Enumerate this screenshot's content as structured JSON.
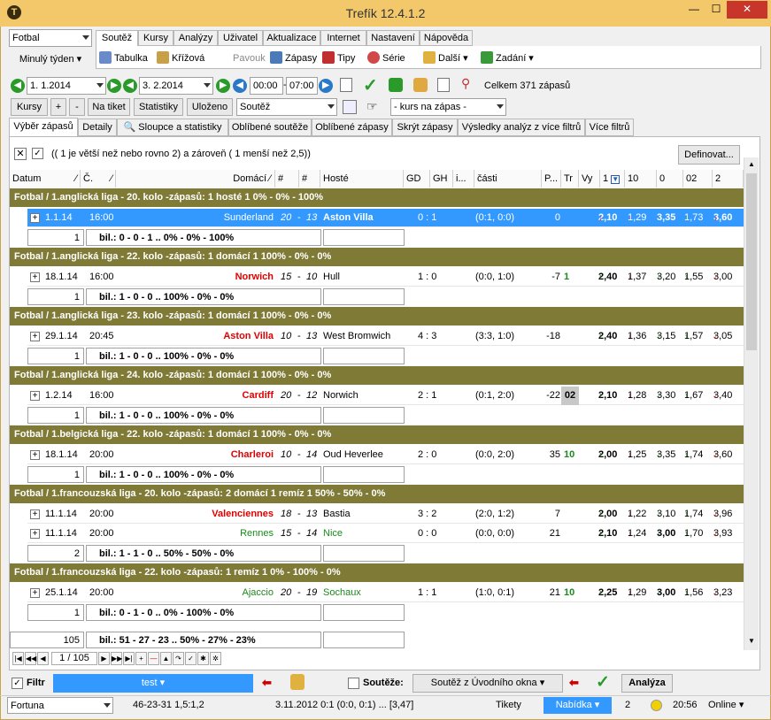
{
  "app": {
    "title": "Trefík 12.4.1.2",
    "min": "—",
    "max": "☐",
    "close": "✕",
    "icon": "T"
  },
  "left": {
    "sport": "Fotbal",
    "period": "Minulý týden"
  },
  "menu": [
    "Soutěž",
    "Kursy",
    "Analýzy",
    "Uživatel",
    "Aktualizace",
    "Internet",
    "Nastavení",
    "Nápověda"
  ],
  "tools": [
    "Tabulka",
    "Křížová",
    "Pavouk",
    "Zápasy",
    "Tipy",
    "Série",
    "Další",
    "Zadání"
  ],
  "dates": {
    "from": "1.  1.2014",
    "to": "3.  2.2014",
    "time_from": "00:00",
    "time_to": "07:00",
    "total": "Celkem 371 zápasů"
  },
  "row3": {
    "kursy": "Kursy",
    "plus": "+",
    "minus": "-",
    "na_tiket": "Na tiket",
    "statistiky": "Statistiky",
    "ulozeno": "Uloženo",
    "soutez": "Soutěž",
    "kurs": "- kurs na zápas -"
  },
  "tabs": [
    "Výběr zápasů",
    "Detaily",
    "Sloupce a statistiky",
    "Oblíbené soutěže",
    "Oblíbené zápasy",
    "Skrýt zápasy",
    "Výsledky analýz z více filtrů",
    "Více filtrů"
  ],
  "filter_text": "(( 1 je větší než nebo rovno 2) a zároveň ( 1 menší než 2,5))",
  "define_btn": "Definovat...",
  "cols": [
    "Datum",
    "Č.",
    "Domácí",
    "#",
    "#",
    "Hosté",
    "GD",
    "GH",
    "i...",
    "části",
    "P...",
    "Tr",
    "Vy",
    "1",
    "10",
    "0",
    "02",
    "2"
  ],
  "groups": [
    {
      "title": "Fotbal / 1.anglická liga - 20. kolo -zápasů: 1   hosté 1     0% - 0% - 100%",
      "rows": [
        {
          "d": "1.1.14",
          "t": "16:00",
          "h": "Sunderland",
          "hc": "n",
          "s1": "20",
          "s2": "13",
          "a": "Aston Villa",
          "ac": "b",
          "sc": "0 : 1",
          "p": "(0:1, 0:0)",
          "pn": "0",
          "tr": "",
          "o1": "2,10",
          "o2": "1,29",
          "o3": "3,35",
          "o4": "1,73",
          "o5": "3,60",
          "sel": true
        }
      ],
      "sum": {
        "n": "1",
        "txt": "bil.: 0 - 0 - 1 .. 0% - 0% - 100%"
      }
    },
    {
      "title": "Fotbal / 1.anglická liga - 22. kolo -zápasů: 1  domácí 1          100% - 0% - 0%",
      "rows": [
        {
          "d": "18.1.14",
          "t": "16:00",
          "h": "Norwich",
          "hc": "r",
          "s1": "15",
          "s2": "10",
          "a": "Hull",
          "ac": "",
          "sc": "1 : 0",
          "p": "(0:0, 1:0)",
          "pn": "-7",
          "tr": "1",
          "o1": "2,40",
          "o2": "1,37",
          "o3": "3,20",
          "o4": "1,55",
          "o5": "3,00"
        }
      ],
      "sum": {
        "n": "1",
        "txt": "bil.: 1 - 0 - 0 .. 100% - 0% - 0%"
      }
    },
    {
      "title": "Fotbal / 1.anglická liga - 23. kolo -zápasů: 1  domácí 1          100% - 0% - 0%",
      "rows": [
        {
          "d": "29.1.14",
          "t": "20:45",
          "h": "Aston Villa",
          "hc": "r",
          "s1": "10",
          "s2": "13",
          "a": "West Bromwich",
          "ac": "",
          "sc": "4 : 3",
          "p": "(3:3, 1:0)",
          "pn": "-18",
          "tr": "",
          "o1": "2,40",
          "o2": "1,36",
          "o3": "3,15",
          "o4": "1,57",
          "o5": "3,05"
        }
      ],
      "sum": {
        "n": "1",
        "txt": "bil.: 1 - 0 - 0 .. 100% - 0% - 0%"
      }
    },
    {
      "title": "Fotbal / 1.anglická liga - 24. kolo -zápasů: 1  domácí 1          100% - 0% - 0%",
      "rows": [
        {
          "d": "1.2.14",
          "t": "16:00",
          "h": "Cardiff",
          "hc": "r",
          "s1": "20",
          "s2": "12",
          "a": "Norwich",
          "ac": "",
          "sc": "2 : 1",
          "p": "(0:1, 2:0)",
          "pn": "-22",
          "tr": "02",
          "o1": "2,10",
          "o2": "1,28",
          "o3": "3,30",
          "o4": "1,67",
          "o5": "3,40"
        }
      ],
      "sum": {
        "n": "1",
        "txt": "bil.: 1 - 0 - 0 .. 100% - 0% - 0%"
      }
    },
    {
      "title": "Fotbal / 1.belgická liga - 22. kolo -zápasů: 1  domácí 1          100% - 0% - 0%",
      "rows": [
        {
          "d": "18.1.14",
          "t": "20:00",
          "h": "Charleroi",
          "hc": "r",
          "s1": "10",
          "s2": "14",
          "a": "Oud Heverlee",
          "ac": "",
          "sc": "2 : 0",
          "p": "(0:0, 2:0)",
          "pn": "35",
          "tr": "10",
          "o1": "2,00",
          "o2": "1,25",
          "o3": "3,35",
          "o4": "1,74",
          "o5": "3,60"
        }
      ],
      "sum": {
        "n": "1",
        "txt": "bil.: 1 - 0 - 0 .. 100% - 0% - 0%"
      }
    },
    {
      "title": "Fotbal / 1.francouzská liga - 20. kolo -zápasů: 2  domácí 1  remíz 1       50% - 50% - 0%",
      "rows": [
        {
          "d": "11.1.14",
          "t": "20:00",
          "h": "Valenciennes",
          "hc": "r",
          "s1": "18",
          "s2": "13",
          "a": "Bastia",
          "ac": "",
          "sc": "3 : 2",
          "p": "(2:0, 1:2)",
          "pn": "7",
          "tr": "",
          "o1": "2,00",
          "o2": "1,22",
          "o3": "3,10",
          "o4": "1,74",
          "o5": "3,96"
        },
        {
          "d": "11.1.14",
          "t": "20:00",
          "h": "Rennes",
          "hc": "g",
          "s1": "15",
          "s2": "14",
          "a": "Nice",
          "ac": "g",
          "sc": "0 : 0",
          "p": "(0:0, 0:0)",
          "pn": "21",
          "tr": "",
          "o1": "2,10",
          "o2": "1,24",
          "o3": "3,00",
          "o4": "1,70",
          "o5": "3,93"
        }
      ],
      "sum": {
        "n": "2",
        "txt": "bil.: 1 - 1 - 0 .. 50% - 50% - 0%"
      }
    },
    {
      "title": "Fotbal / 1.francouzská liga - 22. kolo -zápasů: 1    remíz 1       0% - 100% - 0%",
      "rows": [
        {
          "d": "25.1.14",
          "t": "20:00",
          "h": "Ajaccio",
          "hc": "g",
          "s1": "20",
          "s2": "19",
          "a": "Sochaux",
          "ac": "g",
          "sc": "1 : 1",
          "p": "(1:0, 0:1)",
          "pn": "21",
          "tr": "10",
          "o1": "2,25",
          "o2": "1,29",
          "o3": "3,00",
          "o4": "1,56",
          "o5": "3,23"
        }
      ],
      "sum": {
        "n": "1",
        "txt": "bil.: 0 - 1 - 0 .. 0% - 100% - 0%"
      }
    }
  ],
  "total": {
    "n": "105",
    "txt": "bil.: 51 - 27 - 23 .. 50% - 27% - 23%"
  },
  "pager": "1 / 105",
  "bottom": {
    "filtr": "Filtr",
    "test": "test",
    "soutez": "Soutěže:",
    "soutez_val": "Soutěž z Úvodního okna",
    "analyza": "Analýza"
  },
  "status": {
    "bookie": "Fortuna",
    "s1": "46-23-31  1,5:1,2",
    "s2": "3.11.2012 0:1 (0:0, 0:1) ... [3,47]",
    "tikety": "Tikety",
    "nabidka": "Nabídka",
    "n": "2",
    "time": "20:56",
    "online": "Online"
  }
}
